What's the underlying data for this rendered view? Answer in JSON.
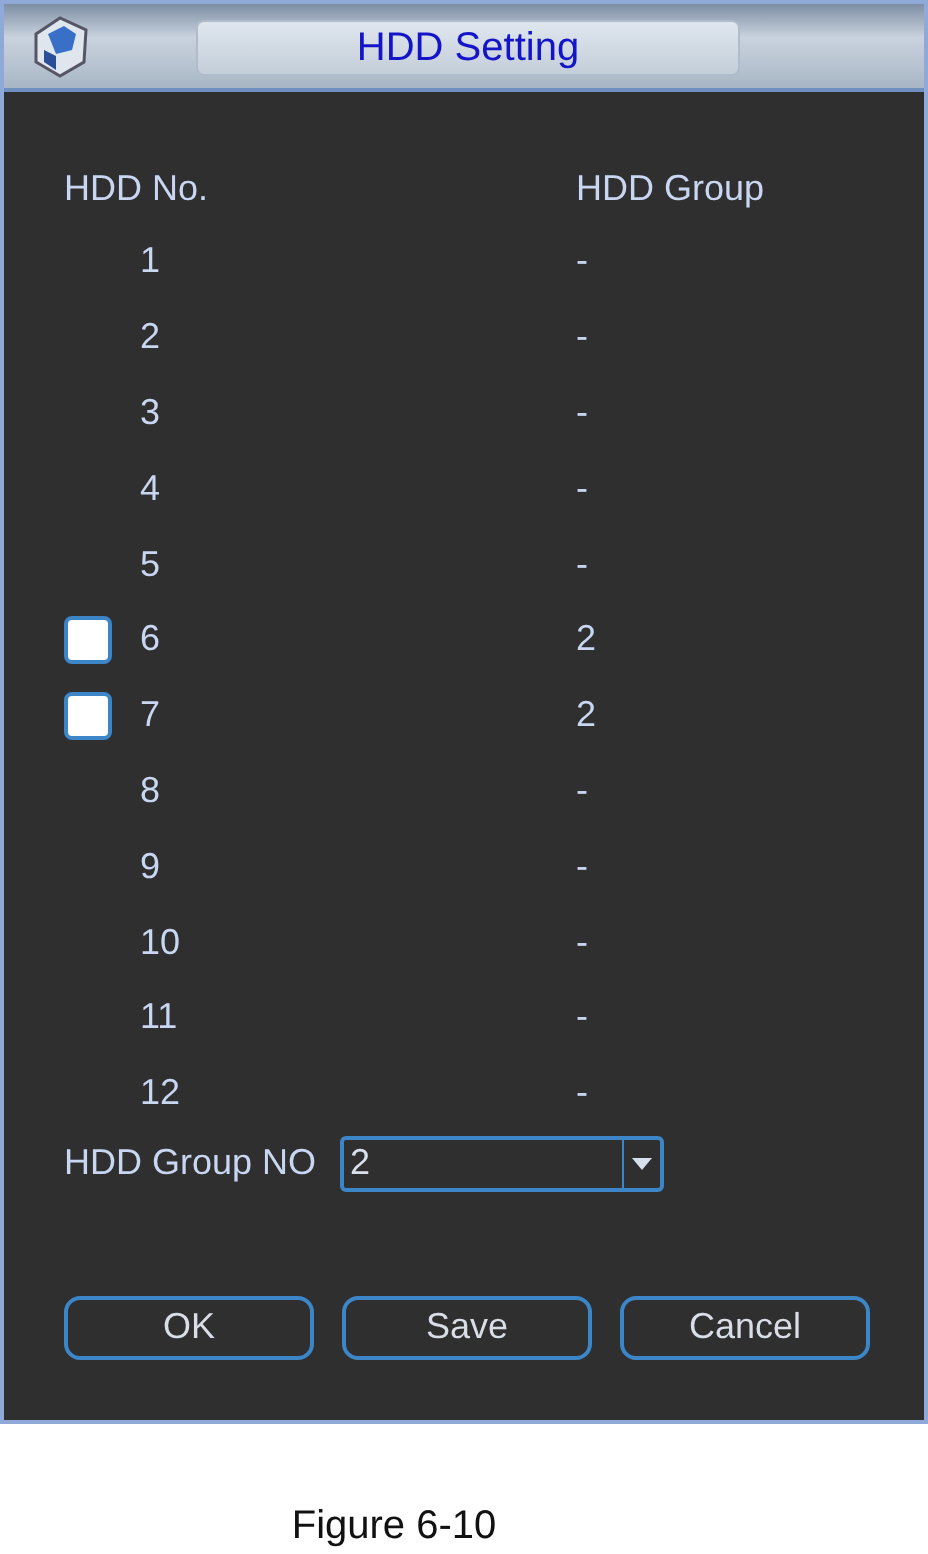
{
  "window": {
    "title": "HDD Setting"
  },
  "table": {
    "columns": [
      "HDD No.",
      "HDD Group"
    ],
    "rows": [
      {
        "kind": "plain",
        "number": "1",
        "group": "-"
      },
      {
        "kind": "plain",
        "number": "2",
        "group": "-"
      },
      {
        "kind": "plain",
        "number": "3",
        "group": "-"
      },
      {
        "kind": "plain",
        "number": "4",
        "group": "-"
      },
      {
        "kind": "plain",
        "number": "5",
        "group": "-"
      },
      {
        "kind": "checkbox",
        "checked": false,
        "number": "6",
        "group": "2"
      },
      {
        "kind": "checkbox",
        "checked": false,
        "number": "7",
        "group": "2"
      },
      {
        "kind": "plain",
        "number": "8",
        "group": "-"
      },
      {
        "kind": "plain",
        "number": "9",
        "group": "-"
      },
      {
        "kind": "plain",
        "number": "10",
        "group": "-"
      },
      {
        "kind": "plain",
        "number": "11",
        "group": "-"
      },
      {
        "kind": "plain",
        "number": "12",
        "group": "-"
      }
    ]
  },
  "group_no": {
    "label": "HDD Group NO",
    "value": "2"
  },
  "buttons": [
    "OK",
    "Save",
    "Cancel"
  ],
  "caption": "Figure 6-10"
}
